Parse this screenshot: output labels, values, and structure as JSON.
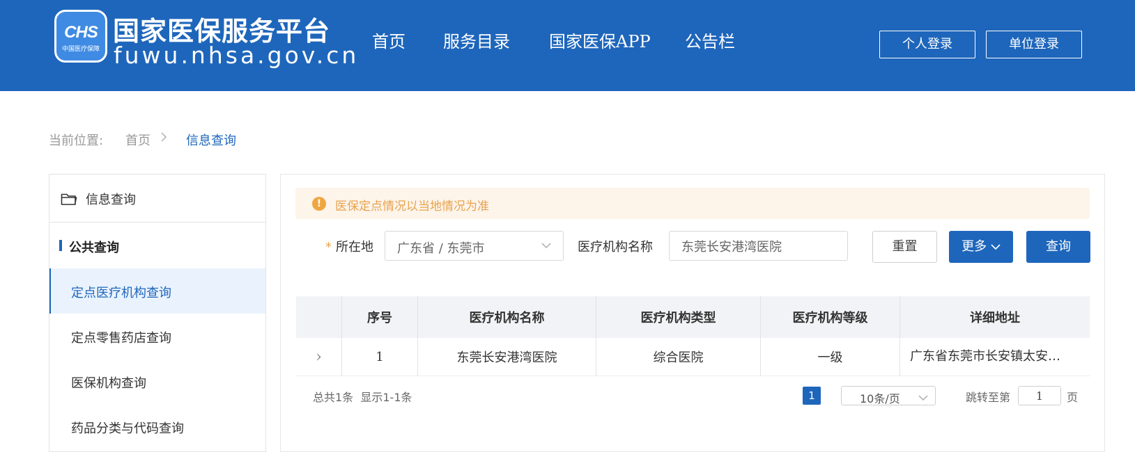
{
  "header": {
    "badge_text": "CHS",
    "badge_org": "中国医疗保障",
    "title": "国家医保服务平台",
    "url": "fuwu.nhsa.gov.cn",
    "nav": [
      "首页",
      "服务目录",
      "国家医保APP",
      "公告栏"
    ],
    "personal_login": "个人登录",
    "unit_login": "单位登录",
    "color": "#1e66bb"
  },
  "breadcrumb": {
    "label": "当前位置:",
    "home": "首页",
    "separator": ">",
    "current": "信息查询"
  },
  "sidebar": {
    "title": "信息查询",
    "group": "公共查询",
    "items": [
      "定点医疗机构查询",
      "定点零售药店查询",
      "医保机构查询",
      "药品分类与代码查询"
    ],
    "active_index": 0
  },
  "notice": {
    "icon": "!",
    "text": "医保定点情况以当地情况为准"
  },
  "filters": {
    "location_label": "所在地",
    "required_mark": "*",
    "location_value": "广东省 / 东莞市",
    "name_label": "医疗机构名称",
    "name_value": "东莞长安港湾医院",
    "reset": "重置",
    "more": "更多",
    "query": "查询"
  },
  "table": {
    "columns": [
      "",
      "序号",
      "医疗机构名称",
      "医疗机构类型",
      "医疗机构等级",
      "详细地址"
    ],
    "rows": [
      {
        "expand": "›",
        "index": "1",
        "name": "东莞长安港湾医院",
        "type": "综合医院",
        "level": "一级",
        "address": "广东省东莞市长安镇太安…"
      }
    ]
  },
  "pagination": {
    "total": "总共1条",
    "range": "显示1-1条",
    "current_page": "1",
    "page_size": "10条/页",
    "jump_label": "跳转至第",
    "jump_value": "1",
    "jump_unit": "页"
  }
}
